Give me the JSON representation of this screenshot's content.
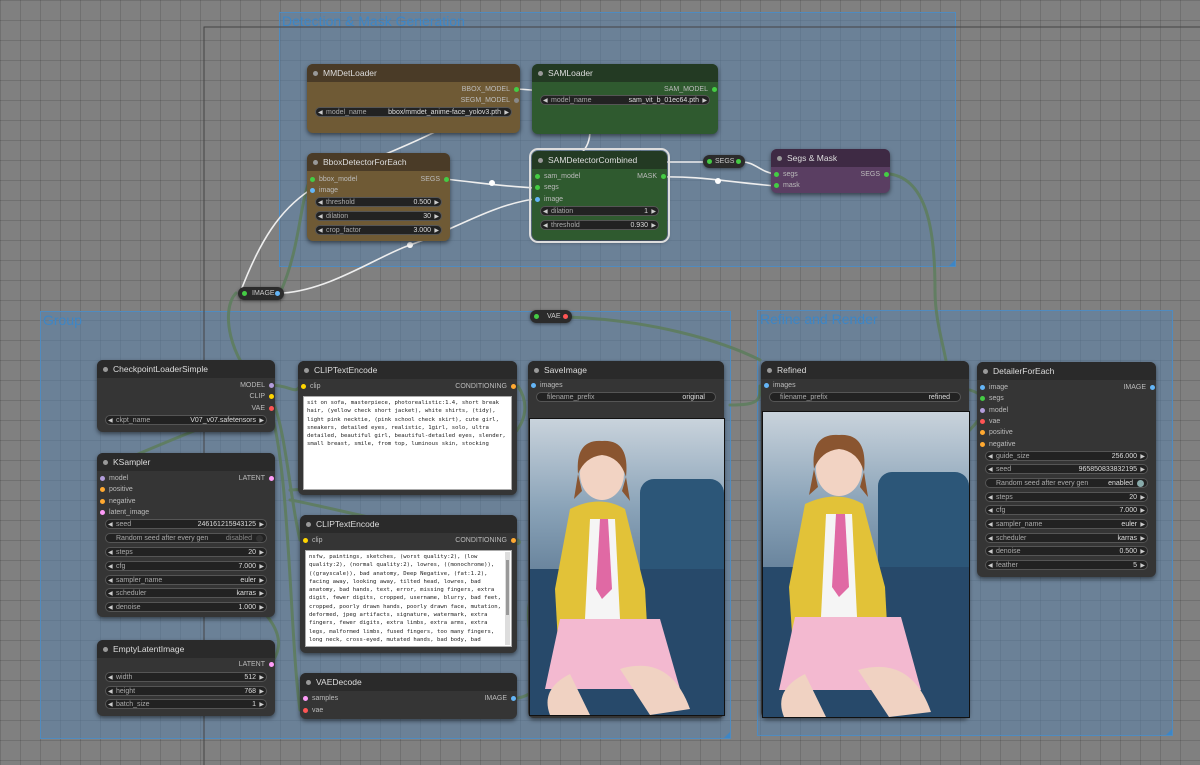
{
  "groups": {
    "detection": "Detection & Mask Generation",
    "group": "Group",
    "refine": "Refine and Render"
  },
  "reroutes": {
    "image": "IMAGE",
    "vae": "VAE",
    "segs": "SEGS"
  },
  "mmdet": {
    "title": "MMDetLoader",
    "out1": "BBOX_MODEL",
    "out2": "SEGM_MODEL",
    "w_model_label": "model_name",
    "w_model_value": "bbox/mmdet_anime-face_yolov3.pth"
  },
  "samloader": {
    "title": "SAMLoader",
    "out1": "SAM_MODEL",
    "w_model_label": "model_name",
    "w_model_value": "sam_vit_b_01ec64.pth"
  },
  "bbox": {
    "title": "BboxDetectorForEach",
    "in1": "bbox_model",
    "in2": "image",
    "out1": "SEGS",
    "threshold_label": "threshold",
    "threshold_value": "0.500",
    "dilation_label": "dilation",
    "dilation_value": "30",
    "crop_label": "crop_factor",
    "crop_value": "3.000"
  },
  "samdet": {
    "title": "SAMDetectorCombined",
    "in1": "sam_model",
    "in2": "segs",
    "in3": "image",
    "out1": "MASK",
    "dilation_label": "dilation",
    "dilation_value": "1",
    "threshold_label": "threshold",
    "threshold_value": "0.930"
  },
  "segsmask": {
    "title": "Segs & Mask",
    "in1": "segs",
    "in2": "mask",
    "out1": "SEGS"
  },
  "ckpt": {
    "title": "CheckpointLoaderSimple",
    "out1": "MODEL",
    "out2": "CLIP",
    "out3": "VAE",
    "ckpt_label": "ckpt_name",
    "ckpt_value": "V07_v07.safetensors"
  },
  "ksampler": {
    "title": "KSampler",
    "in1": "model",
    "in2": "positive",
    "in3": "negative",
    "in4": "latent_image",
    "out1": "LATENT",
    "seed_label": "seed",
    "seed_value": "246161215943125",
    "random_label": "Random seed after every gen",
    "random_value": "disabled",
    "steps_label": "steps",
    "steps_value": "20",
    "cfg_label": "cfg",
    "cfg_value": "7.000",
    "sampler_label": "sampler_name",
    "sampler_value": "euler",
    "scheduler_label": "scheduler",
    "scheduler_value": "karras",
    "denoise_label": "denoise",
    "denoise_value": "1.000"
  },
  "empty": {
    "title": "EmptyLatentImage",
    "out1": "LATENT",
    "width_label": "width",
    "width_value": "512",
    "height_label": "height",
    "height_value": "768",
    "batch_label": "batch_size",
    "batch_value": "1"
  },
  "clip1": {
    "title": "CLIPTextEncode",
    "in1": "clip",
    "out1": "CONDITIONING",
    "text": "sit on sofa, masterpiece, photorealistic:1.4, short break hair, (yellow check short jacket), white shirts, (tidy), light pink necktie, (pink school check skirt), cute girl, sneakers, detailed eyes, realistic, 1girl, solo, ultra detailed, beautiful girl, beautiful-detailed eyes, slender, small breast, smile, from top, luminous skin, stocking"
  },
  "clip2": {
    "title": "CLIPTextEncode",
    "in1": "clip",
    "out1": "CONDITIONING",
    "text": "nsfw, paintings, sketches, (worst quality:2), (low quality:2), (normal quality:2), lowres, ((monochrome)), ((grayscale)), bad anatomy, Deep Negative, (fat:1.2), facing away, looking away, tilted head, lowres, bad anatomy, bad hands, text, error, missing fingers, extra digit, fewer digits, cropped, username, blurry, bad feet, cropped, poorly drawn hands, poorly drawn face, mutation, deformed, jpeg artifacts, signature, watermark, extra fingers, fewer digits, extra limbs, extra arms, extra legs, malformed limbs, fused fingers, too many fingers, long neck, cross-eyed, mutated hands, bad body, bad"
  },
  "vaedecode": {
    "title": "VAEDecode",
    "in1": "samples",
    "in2": "vae",
    "out1": "IMAGE"
  },
  "save": {
    "title": "SaveImage",
    "in1": "images",
    "prefix_label": "filename_prefix",
    "prefix_value": "original"
  },
  "refined": {
    "title": "Refined",
    "in1": "images",
    "prefix_label": "filename_prefix",
    "prefix_value": "refined"
  },
  "detailer": {
    "title": "DetailerForEach",
    "in1": "image",
    "in2": "segs",
    "in3": "model",
    "in4": "vae",
    "in5": "positive",
    "in6": "negative",
    "out1": "IMAGE",
    "guide_label": "guide_size",
    "guide_value": "256.000",
    "seed_label": "seed",
    "seed_value": "965850833832195",
    "random_label": "Random seed after every gen",
    "random_value": "enabled",
    "steps_label": "steps",
    "steps_value": "20",
    "cfg_label": "cfg",
    "cfg_value": "7.000",
    "sampler_label": "sampler_name",
    "sampler_value": "euler",
    "scheduler_label": "scheduler",
    "scheduler_value": "karras",
    "denoise_label": "denoise",
    "denoise_value": "0.500",
    "feather_label": "feather",
    "feather_value": "5"
  },
  "colors": {
    "mmdet_header": "#4a3b27",
    "mmdet_body": "#6f5a35",
    "sam_header": "#233a23",
    "sam_body": "#2f5a2f",
    "segsmask_header": "#3e2a44",
    "segsmask_body": "#5a3e62",
    "group_accent": "#3d86c6"
  }
}
